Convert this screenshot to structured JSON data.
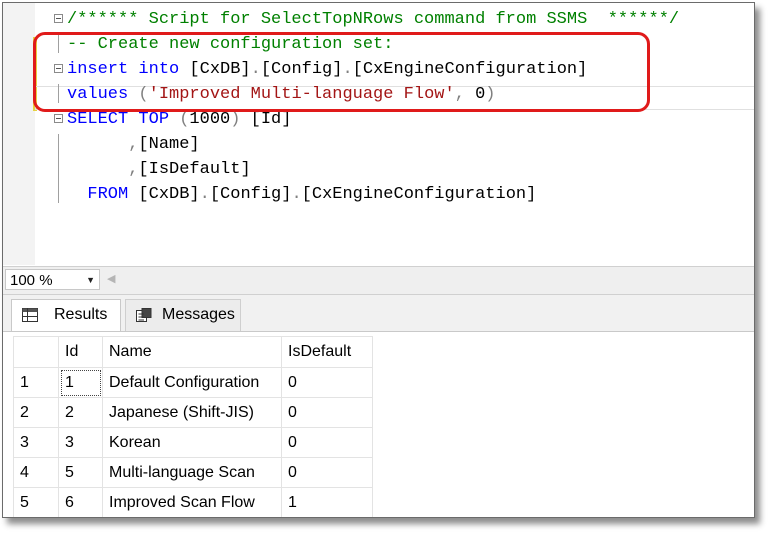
{
  "editor": {
    "lines": [
      {
        "parts": [
          {
            "c": "cm",
            "t": "/****** Script for SelectTopNRows command from SSMS  ******/"
          }
        ]
      },
      {
        "parts": [
          {
            "c": "cm",
            "t": "-- Create new configuration set:"
          }
        ]
      },
      {
        "parts": [
          {
            "c": "kw",
            "t": "insert into "
          },
          {
            "c": "txt",
            "t": "[CxDB]"
          },
          {
            "c": "gray",
            "t": "."
          },
          {
            "c": "txt",
            "t": "[Config]"
          },
          {
            "c": "gray",
            "t": "."
          },
          {
            "c": "txt",
            "t": "[CxEngineConfiguration]"
          }
        ]
      },
      {
        "parts": [
          {
            "c": "kw",
            "t": "values "
          },
          {
            "c": "gray",
            "t": "("
          },
          {
            "c": "str",
            "t": "'Improved Multi-language Flow'"
          },
          {
            "c": "gray",
            "t": ", "
          },
          {
            "c": "txt",
            "t": "0"
          },
          {
            "c": "gray",
            "t": ")"
          }
        ]
      },
      {
        "parts": [
          {
            "c": "kw",
            "t": "SELECT TOP "
          },
          {
            "c": "gray",
            "t": "("
          },
          {
            "c": "txt",
            "t": "1000"
          },
          {
            "c": "gray",
            "t": ") "
          },
          {
            "c": "txt",
            "t": "[Id]"
          }
        ]
      },
      {
        "parts": [
          {
            "c": "txt",
            "t": "      "
          },
          {
            "c": "gray",
            "t": ","
          },
          {
            "c": "txt",
            "t": "[Name]"
          }
        ]
      },
      {
        "parts": [
          {
            "c": "txt",
            "t": "      "
          },
          {
            "c": "gray",
            "t": ","
          },
          {
            "c": "txt",
            "t": "[IsDefault]"
          }
        ]
      },
      {
        "parts": [
          {
            "c": "kw",
            "t": "  FROM "
          },
          {
            "c": "txt",
            "t": "[CxDB]"
          },
          {
            "c": "gray",
            "t": "."
          },
          {
            "c": "txt",
            "t": "[Config]"
          },
          {
            "c": "gray",
            "t": "."
          },
          {
            "c": "txt",
            "t": "[CxEngineConfiguration]"
          }
        ]
      }
    ]
  },
  "zoom": {
    "value": "100 %"
  },
  "tabs": {
    "results": "Results",
    "messages": "Messages"
  },
  "grid": {
    "headers": [
      "",
      "Id",
      "Name",
      "IsDefault"
    ],
    "rows": [
      [
        "1",
        "1",
        "Default Configuration",
        "0"
      ],
      [
        "2",
        "2",
        "Japanese (Shift-JIS)",
        "0"
      ],
      [
        "3",
        "3",
        "Korean",
        "0"
      ],
      [
        "4",
        "5",
        "Multi-language Scan",
        "0"
      ],
      [
        "5",
        "6",
        "Improved Scan Flow",
        "1"
      ]
    ]
  },
  "colors": {
    "highlight": "#e01a1a",
    "keyword": "#0000ff",
    "comment": "#008000",
    "string": "#a31515"
  }
}
